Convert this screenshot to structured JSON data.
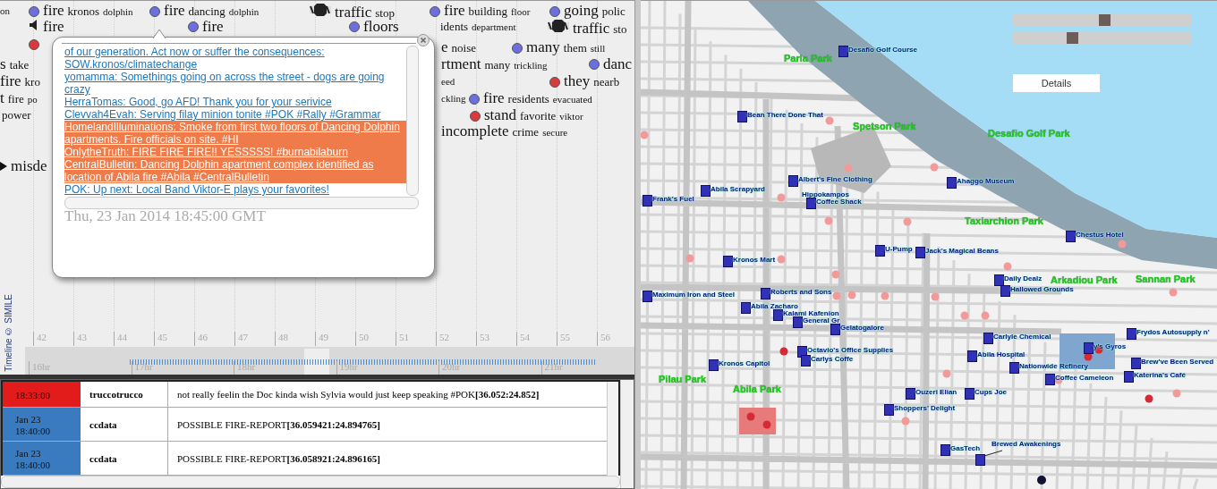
{
  "timeline": {
    "events": [
      {
        "kind": "none",
        "words": [
          "on"
        ]
      },
      {
        "kind": "dot",
        "color": "#6b6fe0",
        "words": [
          "fire",
          "kronos",
          "dolphin"
        ]
      },
      {
        "kind": "dot",
        "color": "#6b6fe0",
        "words": [
          "fire",
          "dancing",
          "dolphin"
        ]
      },
      {
        "kind": "stop",
        "words": [
          "traffic",
          "stop"
        ]
      },
      {
        "kind": "dot",
        "color": "#6b6fe0",
        "words": [
          "fire",
          "building",
          "floor"
        ]
      },
      {
        "kind": "dot",
        "color": "#6b6fe0",
        "words": [
          "going",
          "polic"
        ]
      },
      {
        "kind": "speaker",
        "words": [
          "fire"
        ]
      },
      {
        "kind": "dot",
        "color": "#6b6fe0",
        "words": [
          "fire"
        ]
      },
      {
        "kind": "dot",
        "color": "#6b6fe0",
        "words": [
          "floors"
        ]
      },
      {
        "kind": "none",
        "words": [
          "idents",
          "department"
        ]
      },
      {
        "kind": "stop",
        "words": [
          "traffic",
          "sto"
        ]
      },
      {
        "kind": "dot",
        "color": "#d93a3c"
      },
      {
        "kind": "none",
        "words": [
          "e",
          "noise"
        ]
      },
      {
        "kind": "dot",
        "color": "#6b6fe0",
        "words": [
          "many",
          "them",
          "still"
        ]
      },
      {
        "kind": "none",
        "words": [
          "s",
          "take"
        ]
      },
      {
        "kind": "none",
        "words": [
          "rtment",
          "many",
          "trickling"
        ]
      },
      {
        "kind": "dot",
        "color": "#6b6fe0",
        "words": [
          "danc"
        ]
      },
      {
        "kind": "none",
        "words": [
          "fire",
          "kro"
        ]
      },
      {
        "kind": "none",
        "words": [
          "eed"
        ]
      },
      {
        "kind": "dot",
        "color": "#d93a3c",
        "words": [
          "they",
          "nearb"
        ]
      },
      {
        "kind": "none",
        "words": [
          "t",
          "fire",
          "po"
        ]
      },
      {
        "kind": "none",
        "words": [
          "ckling"
        ]
      },
      {
        "kind": "dot",
        "color": "#6b6fe0",
        "words": [
          "fire",
          "residents",
          "evacuated"
        ]
      },
      {
        "kind": "none",
        "words": [
          "power"
        ]
      },
      {
        "kind": "dot",
        "color": "#d93a3c",
        "words": [
          "stand",
          "favorite",
          "viktor"
        ]
      },
      {
        "kind": "none",
        "words": [
          "incomplete",
          "crime",
          "secure"
        ]
      },
      {
        "kind": "arrow",
        "words": [
          "misde"
        ]
      }
    ],
    "popup": {
      "tweets": [
        {
          "text": "of our generation. Act now or suffer the consequences: SOW.kronos/climatechange",
          "highlighted": false
        },
        {
          "text": "yomamma: Somethings going on across the street - dogs are going crazy",
          "highlighted": false
        },
        {
          "text": "HerraTomas: Good, go AFD! Thank you for your serivice",
          "highlighted": false
        },
        {
          "text": "Clevvah4Evah: Serving filay minion tonite #POK #Rally #Grammar",
          "highlighted": false
        },
        {
          "text": "HomelandIlluminations: Smoke from first two floors of Dancing Dolphin apartments. Fire officials on site. #HI",
          "highlighted": true
        },
        {
          "text": "OnlytheTruth: FIRE FIRE FIRE!! YESSSSS! #burnabilaburn",
          "highlighted": true
        },
        {
          "text": "CentralBulletin: Dancing Dolphin apartment complex identified as location of Abila fire #Abila #CentralBulletin",
          "highlighted": true
        },
        {
          "text": "POK: Up next: Local Band Viktor-E plays your favorites!",
          "highlighted": false
        }
      ],
      "date": "Thu, 23 Jan 2014 18:45:00 GMT"
    },
    "minute_labels": [
      "42",
      "43",
      "44",
      "45",
      "46",
      "47",
      "48",
      "49",
      "50",
      "51",
      "52",
      "53",
      "54",
      "55",
      "56"
    ],
    "hour_labels": [
      "16hr",
      "17hr",
      "18hr",
      "19hr",
      "20hr",
      "21hr"
    ],
    "credit": "Timeline © SIMILE"
  },
  "table": {
    "rows": [
      {
        "date": [
          "18:33:00"
        ],
        "color": "#e21b1b",
        "user": "truccotrucco",
        "message": "not really feelin the Doc kinda wish Sylvia would just keep speaking #POK**[36.052:24.852]**"
      },
      {
        "date": [
          "Jan 23",
          "18:40:00"
        ],
        "color": "#3a7bbf",
        "user": "ccdata",
        "message": "POSSIBLE FIRE-REPORT**[36.059421:24.894765]**"
      },
      {
        "date": [
          "Jan 23",
          "18:40:00"
        ],
        "color": "#3a7bbf",
        "user": "ccdata",
        "message": "POSSIBLE FIRE-REPORT**[36.058921:24.896165]**"
      }
    ]
  },
  "map": {
    "sliders": [
      {
        "level": 0.51
      },
      {
        "level": 0.33
      }
    ],
    "details_button": "Details",
    "parks": [
      "Parla Park",
      "Spetson Park",
      "Desafio Golf Park",
      "Taxiarchion Park",
      "Arkadiou Park",
      "Sannan Park",
      "Pilau Park",
      "Abila Park"
    ],
    "places": [
      {
        "name": "Desafio Golf Course",
        "kind": "marker"
      },
      {
        "name": "Bean There Done That",
        "kind": "marker"
      },
      {
        "name": "Albert's Fine Clothing",
        "kind": "marker"
      },
      {
        "name": "Hippokampos",
        "kind": "label"
      },
      {
        "name": "Abila Scrapyard",
        "kind": "marker"
      },
      {
        "name": "Frank's Fuel",
        "kind": "marker"
      },
      {
        "name": "Coffee Shack",
        "kind": "marker"
      },
      {
        "name": "Ahaggo Museum",
        "kind": "marker"
      },
      {
        "name": "Chestus Hotel",
        "kind": "marker"
      },
      {
        "name": "Kronos Mart",
        "kind": "marker"
      },
      {
        "name": "U-Pump",
        "kind": "marker"
      },
      {
        "name": "Jack's Magical Beans",
        "kind": "marker"
      },
      {
        "name": "Daily Dealz",
        "kind": "marker"
      },
      {
        "name": "Hallowed Grounds",
        "kind": "marker"
      },
      {
        "name": "Maximum Iron and Steel",
        "kind": "marker"
      },
      {
        "name": "Roberts and Sons",
        "kind": "marker"
      },
      {
        "name": "Abila Zacharo",
        "kind": "marker"
      },
      {
        "name": "Kalami Kafenion",
        "kind": "marker"
      },
      {
        "name": "General Gr",
        "kind": "marker"
      },
      {
        "name": "Gelatogalore",
        "kind": "marker"
      },
      {
        "name": "Carlyle Chemical",
        "kind": "marker"
      },
      {
        "name": "Frydos Autosupply n'",
        "kind": "marker"
      },
      {
        "name": "Octavio's Office Supplies",
        "kind": "marker"
      },
      {
        "name": "Carlys Coffe",
        "kind": "marker"
      },
      {
        "name": "Kronos Capitol",
        "kind": "marker"
      },
      {
        "name": "Abila Hospital",
        "kind": "marker"
      },
      {
        "name": "Nationwide Refinery",
        "kind": "marker"
      },
      {
        "name": "Coffee Cameleon",
        "kind": "marker"
      },
      {
        "name": "Brew've Been Served",
        "kind": "marker"
      },
      {
        "name": "Katerina's Café",
        "kind": "marker"
      },
      {
        "name": "y's Gyros",
        "kind": "marker"
      },
      {
        "name": "Ouzeri Elian",
        "kind": "marker"
      },
      {
        "name": "Cups Joe",
        "kind": "marker"
      },
      {
        "name": "Shoppers' Delight",
        "kind": "marker"
      },
      {
        "name": "GasTech",
        "kind": "marker"
      },
      {
        "name": "Brewed Awakenings",
        "kind": "leader"
      }
    ]
  }
}
